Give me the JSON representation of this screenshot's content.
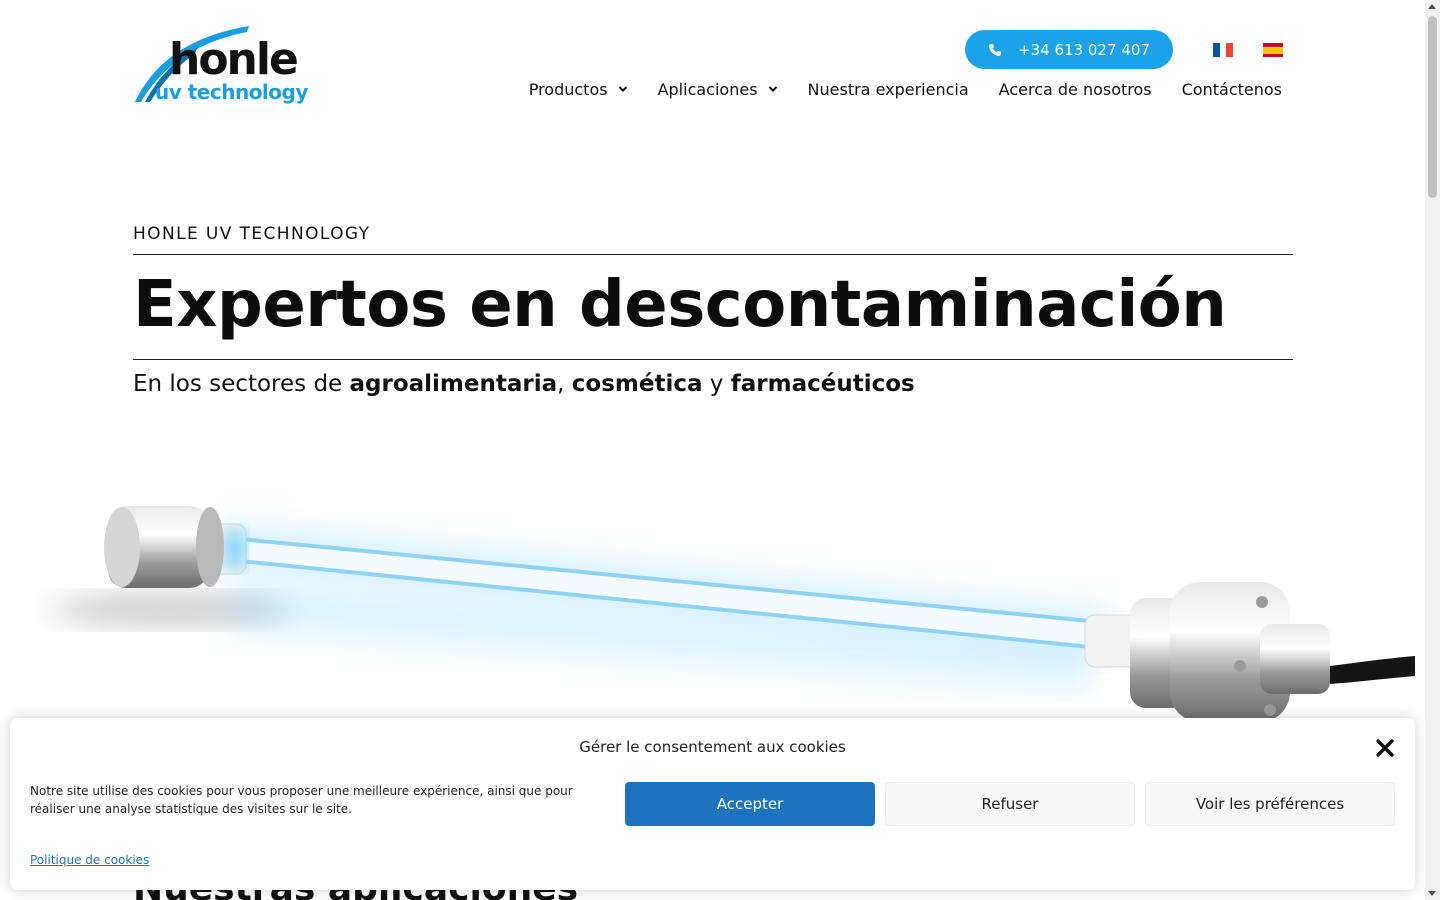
{
  "header": {
    "logo": {
      "line1": "honle",
      "line2": "uv technology"
    },
    "phone": "+34 613 027 407",
    "languages": [
      "fr",
      "es"
    ],
    "nav": [
      {
        "label": "Productos",
        "dropdown": true
      },
      {
        "label": "Aplicaciones",
        "dropdown": true
      },
      {
        "label": "Nuestra experiencia",
        "dropdown": false
      },
      {
        "label": "Acerca de nosotros",
        "dropdown": false
      },
      {
        "label": "Contáctenos",
        "dropdown": false
      }
    ]
  },
  "hero": {
    "eyebrow": "HONLE UV TECHNOLOGY",
    "headline": "Expertos en descontaminación",
    "subline": {
      "prefix": "En los sectores de ",
      "term1": "agroalimentaria",
      "sep1": ", ",
      "term2": "cosmética",
      "sep2": " y ",
      "term3": "farmacéuticos"
    }
  },
  "next_section": {
    "title": "Nuestras aplicaciones"
  },
  "cookie_banner": {
    "title": "Gérer le consentement aux cookies",
    "text": "Notre site utilise des cookies pour vous proposer une meilleure expérience, ainsi que pour réaliser une analyse statistique des visites sur le site.",
    "accept": "Accepter",
    "refuse": "Refuser",
    "preferences": "Voir les préférences",
    "policy_link": "Politique de cookies"
  },
  "colors": {
    "accent": "#1aa3e8",
    "accept_button": "#1e73be",
    "text": "#111111"
  }
}
